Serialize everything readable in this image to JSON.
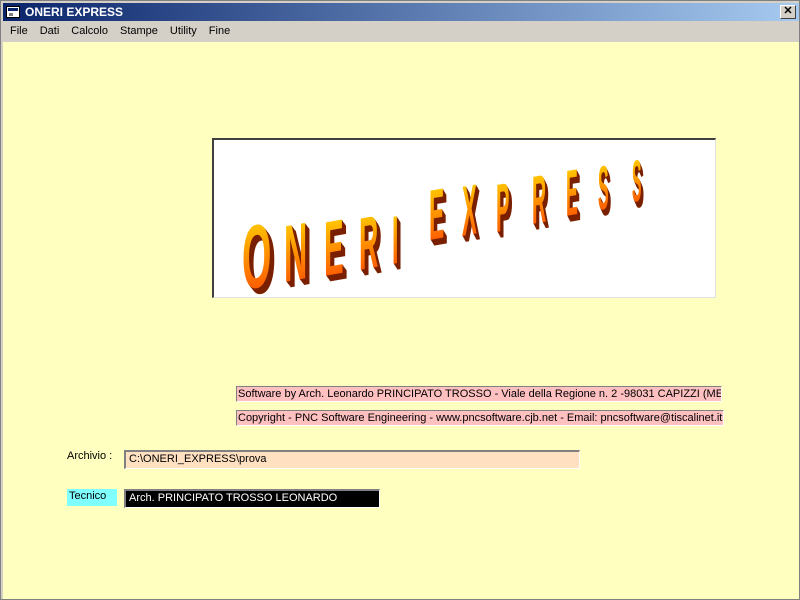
{
  "window": {
    "title": "ONERI EXPRESS",
    "close_label": "✕",
    "icon": "app-window-icon"
  },
  "menu": {
    "items": [
      {
        "label": "File"
      },
      {
        "label": "Dati"
      },
      {
        "label": "Calcolo"
      },
      {
        "label": "Stampe"
      },
      {
        "label": "Utility"
      },
      {
        "label": "Fine"
      }
    ]
  },
  "logo": {
    "text": "ONERI EXPRESS",
    "letters": [
      "O",
      "N",
      "E",
      "R",
      "I",
      "E",
      "X",
      "P",
      "R",
      "E",
      "S",
      "S"
    ],
    "colors": {
      "top": "#ffe000",
      "bottom": "#ff4000",
      "shadow": "#7a2000"
    }
  },
  "info": {
    "author": "Software by Arch. Leonardo PRINCIPATO TROSSO - Viale della Regione n. 2 -98031   CAPIZZI (ME)",
    "copyright": "Copyright - PNC Software Engineering - www.pncsoftware.cjb.net - Email: pncsoftware@tiscalinet.it"
  },
  "fields": {
    "archivio_label": "Archivio :",
    "archivio_value": "C:\\ONERI_EXPRESS\\prova",
    "tecnico_label": "Tecnico",
    "tecnico_value": "Arch. PRINCIPATO TROSSO LEONARDO"
  },
  "colors": {
    "client_bg": "#ffffc0",
    "titlebar_start": "#0a246a",
    "info_bg": "#ffc0c0",
    "archivio_bg": "#ffe0c0",
    "tecnico_label_bg": "#80ffff",
    "tecnico_input_bg": "#000000"
  }
}
